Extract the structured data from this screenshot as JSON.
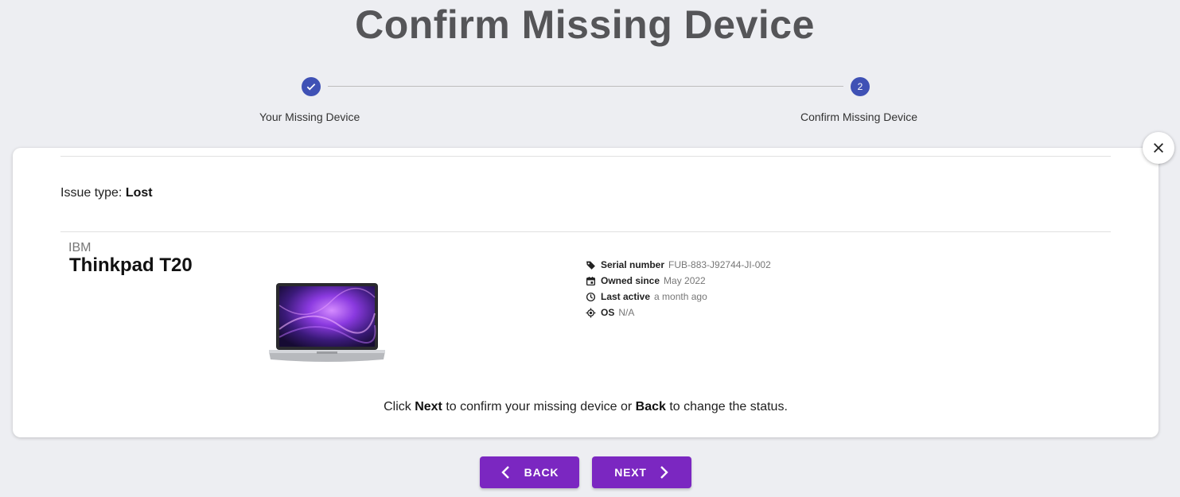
{
  "page": {
    "title": "Confirm Missing Device"
  },
  "stepper": {
    "steps": [
      {
        "label": "Your Missing Device",
        "state": "completed",
        "icon": "check-icon"
      },
      {
        "label": "Confirm Missing Device",
        "number": "2",
        "state": "active"
      }
    ],
    "active_color": "#3f51b5"
  },
  "issue": {
    "label": "Issue type:",
    "value": "Lost"
  },
  "device": {
    "brand": "IBM",
    "model": "Thinkpad T20",
    "image": "laptop-image",
    "specs": [
      {
        "icon": "tag-icon",
        "key": "Serial number",
        "value": "FUB-883-J92744-JI-002"
      },
      {
        "icon": "calendar-icon",
        "key": "Owned since",
        "value": "May 2022"
      },
      {
        "icon": "clock-icon",
        "key": "Last active",
        "value": "a month ago"
      },
      {
        "icon": "target-icon",
        "key": "OS",
        "value": "N/A"
      }
    ]
  },
  "instruction": {
    "part1": "Click ",
    "next_word": "Next",
    "part2": " to confirm your missing device or ",
    "back_word": "Back",
    "part3": " to change the status."
  },
  "buttons": {
    "back_label": "BACK",
    "next_label": "NEXT",
    "color": "#7b27c1"
  }
}
